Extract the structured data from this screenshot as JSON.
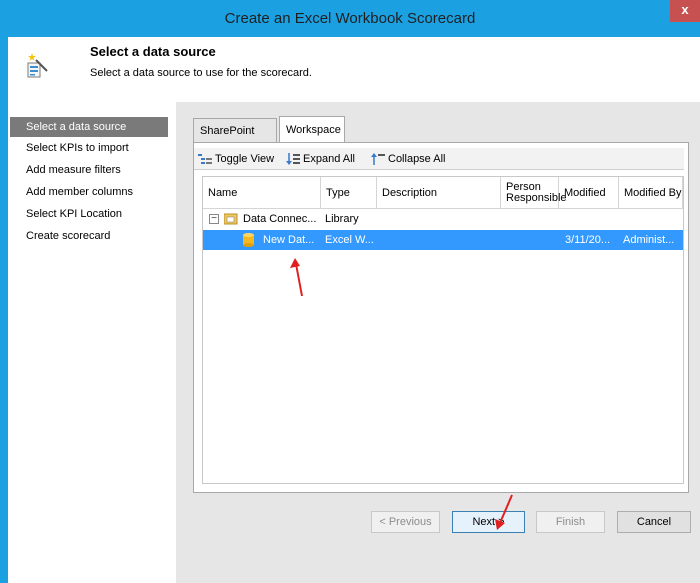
{
  "window": {
    "title": "Create an Excel Workbook Scorecard",
    "close_label": "x",
    "accent": "#1ba1e2"
  },
  "header": {
    "title": "Select a data source",
    "subtitle": "Select a data source to use for the scorecard."
  },
  "sidebar": {
    "items": [
      {
        "label": "Select a data source",
        "active": true
      },
      {
        "label": "Select KPIs to import",
        "active": false
      },
      {
        "label": "Add measure filters",
        "active": false
      },
      {
        "label": "Add member columns",
        "active": false
      },
      {
        "label": "Select KPI Location",
        "active": false
      },
      {
        "label": "Create scorecard",
        "active": false
      }
    ]
  },
  "tabs": [
    {
      "label": "SharePoint Site",
      "selected": false
    },
    {
      "label": "Workspace",
      "selected": true
    }
  ],
  "toolbar": {
    "toggle_view": "Toggle View",
    "expand_all": "Expand All",
    "collapse_all": "Collapse All"
  },
  "grid": {
    "columns": [
      "Name",
      "Type",
      "Description",
      "Person Responsible",
      "Modified",
      "Modified By"
    ],
    "rows": [
      {
        "expander": "−",
        "name": "Data Connec...",
        "type": "Library",
        "description": "",
        "person": "",
        "modified": "",
        "modified_by": "",
        "selected": false
      },
      {
        "expander": "",
        "name": "New Dat...",
        "type": "Excel W...",
        "description": "",
        "person": "",
        "modified": "3/11/20...",
        "modified_by": "Administ...",
        "selected": true
      }
    ]
  },
  "footer": {
    "previous": "< Previous",
    "next": "Next >",
    "finish": "Finish",
    "cancel": "Cancel"
  },
  "annotations": {
    "arrow_color": "#e02020"
  }
}
